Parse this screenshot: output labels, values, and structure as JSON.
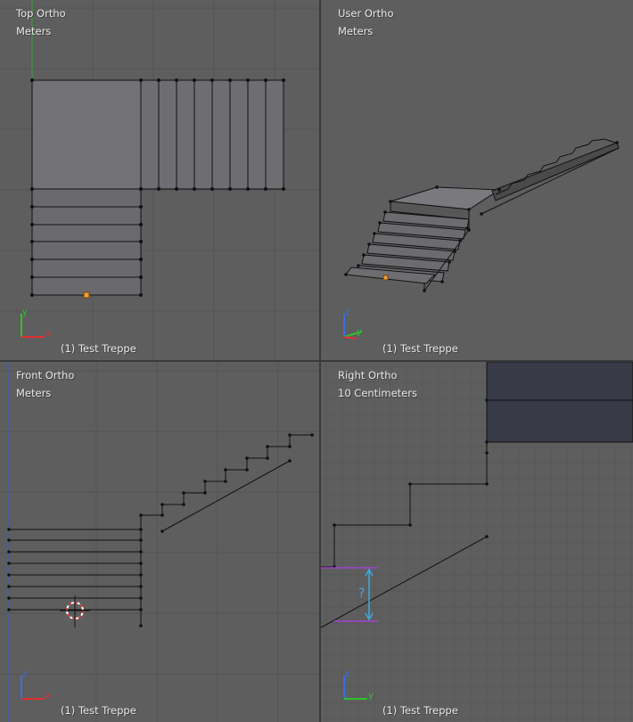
{
  "viewports": {
    "top_left": {
      "view": "Top Ortho",
      "units": "Meters",
      "object": "(1) Test Treppe",
      "axes": [
        "y",
        "x"
      ]
    },
    "top_right": {
      "view": "User Ortho",
      "units": "Meters",
      "object": "(1) Test Treppe",
      "axes": [
        "z",
        "y"
      ]
    },
    "bottom_left": {
      "view": "Front Ortho",
      "units": "Meters",
      "object": "(1) Test Treppe",
      "axes": [
        "z",
        "x"
      ]
    },
    "bottom_right": {
      "view": "Right Ortho",
      "units": "10 Centimeters",
      "object": "(1) Test Treppe",
      "axes": [
        "z",
        "y"
      ]
    }
  },
  "annotation": {
    "label": "?"
  },
  "colors": {
    "background": "#5e5e5e",
    "grid": "#545454",
    "mesh_face": "#6e6e72",
    "edge": "#111111",
    "selected_face": "#393a48",
    "origin": "#f0a030",
    "x_axis": "#e03030",
    "y_axis": "#30c030",
    "z_axis": "#3a6fe0",
    "measure": "#40a8e0",
    "guide": "#a040d0"
  }
}
